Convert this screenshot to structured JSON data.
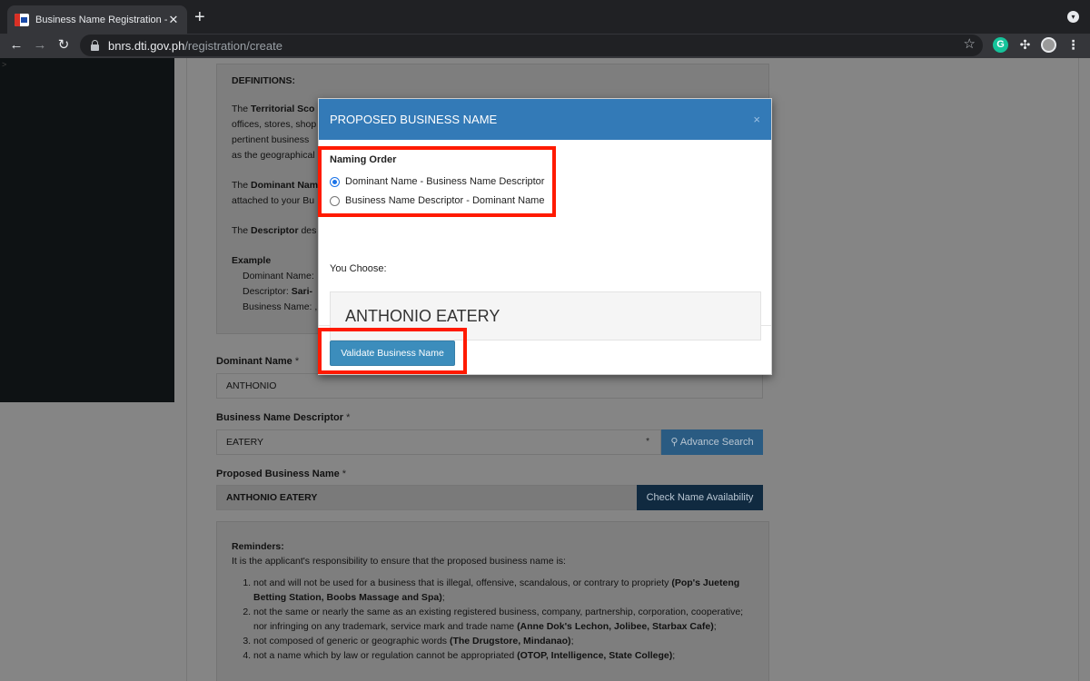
{
  "browser": {
    "tab_title": "Business Name Registration - I",
    "tab_close": "✕",
    "new_tab": "+",
    "url_host": "bnrs.dti.gov.ph",
    "url_path": "/registration/create"
  },
  "sidebar": {
    "marker": ">"
  },
  "definitions": {
    "heading": "DEFINITIONS:",
    "p1_prefix": "The ",
    "p1_bold": "Territorial Sco",
    "p1_line2": "offices, stores, shop",
    "p1_line3": "pertinent business",
    "p1_line4": "as the geographical",
    "p2_prefix": "The ",
    "p2_bold": "Dominant Nam",
    "p2_line2": "attached to your Bu",
    "p3_prefix": "The ",
    "p3_bold": "Descriptor",
    "p3_rest": " des",
    "example_heading": "Example",
    "ex_dominant": "Dominant Name:",
    "ex_descriptor": "Descriptor: ",
    "ex_descriptor_bold": "Sari-",
    "ex_business": "Business Name: ,"
  },
  "form": {
    "dominant_label": "Dominant Name",
    "dominant_value": "ANTHONIO",
    "descriptor_label": "Business Name Descriptor",
    "descriptor_value": "EATERY",
    "advance_search": "Advance Search",
    "proposed_label": "Proposed Business Name",
    "proposed_value": "ANTHONIO EATERY",
    "check_availability": "Check Name Availability",
    "required_mark": "*"
  },
  "reminders": {
    "heading": "Reminders:",
    "intro": "It is the applicant's responsibility to ensure that the proposed business name is:",
    "items": [
      {
        "text": "not and will not be used for a business that is illegal, offensive, scandalous, or contrary to propriety ",
        "bold": "(Pop's Jueteng Betting Station, Boobs Massage and Spa)",
        "end": ";"
      },
      {
        "text": "not the same or nearly the same as an existing registered business, company, partnership, corporation, cooperative; nor infringing on any trademark, service mark and trade name ",
        "bold": "(Anne Dok's Lechon, Jolibee, Starbax Cafe)",
        "end": ";"
      },
      {
        "text": "not composed of generic or geographic words ",
        "bold": "(The Drugstore, Mindanao)",
        "end": ";"
      },
      {
        "text": "not a name which by law or regulation cannot be appropriated ",
        "bold": "(OTOP, Intelligence, State College)",
        "end": ";"
      }
    ]
  },
  "modal": {
    "title": "PROPOSED BUSINESS NAME",
    "close": "×",
    "naming_order_label": "Naming Order",
    "option1": "Dominant Name - Business Name Descriptor",
    "option2": "Business Name Descriptor - Dominant Name",
    "selected_option": 1,
    "you_choose_label": "You Choose:",
    "chosen_name": "ANTHONIO EATERY",
    "validate_button": "Validate Business Name"
  },
  "colors": {
    "modal_header": "#337ab7",
    "validate_button": "#3c8dbc",
    "highlight": "#ff1a00"
  }
}
